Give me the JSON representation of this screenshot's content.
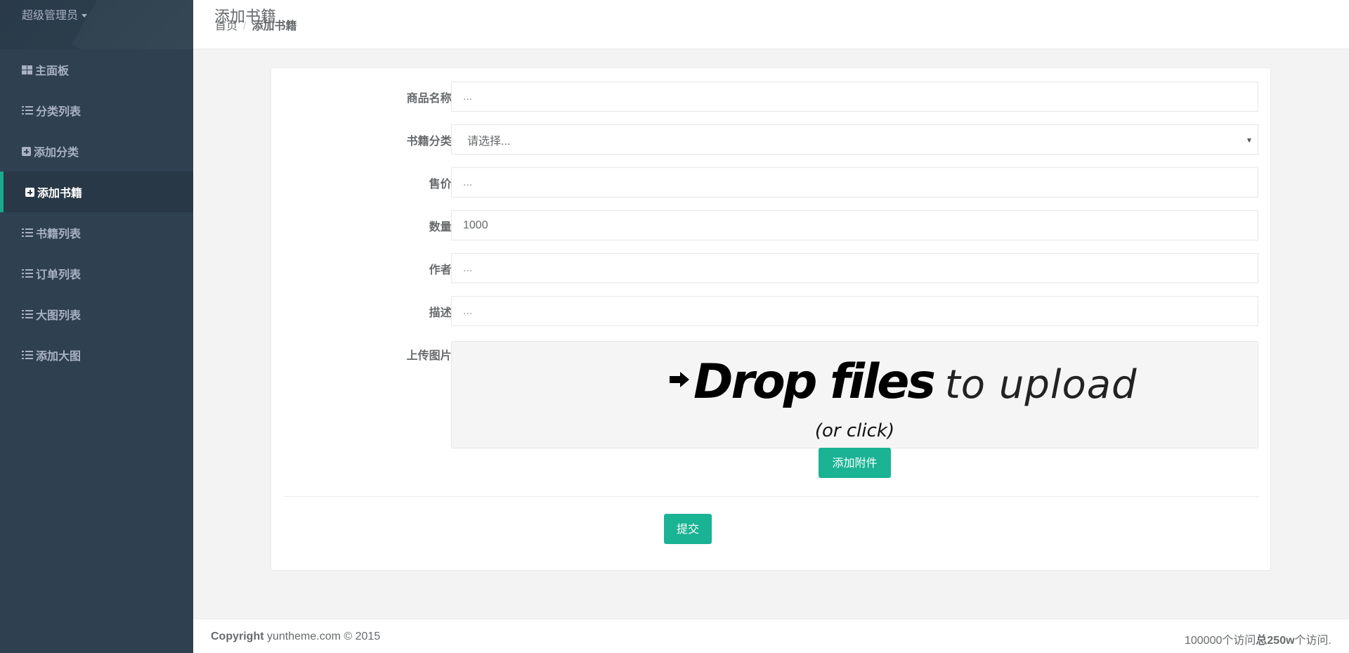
{
  "sidebar": {
    "user_name": "超级管理员",
    "items": [
      {
        "label": "主面板",
        "icon": "th-large-icon"
      },
      {
        "label": "分类列表",
        "icon": "list-icon"
      },
      {
        "label": "添加分类",
        "icon": "plus-square-icon"
      },
      {
        "label": "添加书籍",
        "icon": "plus-square-icon",
        "active": true
      },
      {
        "label": "书籍列表",
        "icon": "list-icon"
      },
      {
        "label": "订单列表",
        "icon": "list-icon"
      },
      {
        "label": "大图列表",
        "icon": "list-icon"
      },
      {
        "label": "添加大图",
        "icon": "list-icon"
      }
    ]
  },
  "header": {
    "title": "添加书籍",
    "breadcrumb_home": "首页",
    "breadcrumb_sep": "/",
    "breadcrumb_current": "添加书籍"
  },
  "form": {
    "name": {
      "label": "商品名称:",
      "placeholder": "...",
      "value": ""
    },
    "category": {
      "label": "书籍分类:",
      "selected": "请选择..."
    },
    "price": {
      "label": "售价:",
      "placeholder": "...",
      "value": ""
    },
    "quantity": {
      "label": "数量:",
      "placeholder": "...",
      "value": "1000"
    },
    "author": {
      "label": "作者:",
      "placeholder": "...",
      "value": ""
    },
    "description": {
      "label": "描述:",
      "placeholder": "...",
      "value": ""
    },
    "upload": {
      "label": "上传图片:",
      "drop_bold": "Drop files",
      "drop_light": "to upload",
      "sub": "(or click)"
    },
    "attach_button": "添加附件",
    "submit_button": "提交"
  },
  "footer": {
    "copyright_bold": "Copyright",
    "copyright_text": "yuntheme.com © 2015",
    "visits_pre": "100000个访问",
    "visits_bold": "总250w",
    "visits_post": "个访问."
  },
  "colors": {
    "sidebar_bg": "#2f4050",
    "sidebar_active_bg": "#293846",
    "accent": "#1ab394",
    "page_bg": "#f3f3f4"
  }
}
